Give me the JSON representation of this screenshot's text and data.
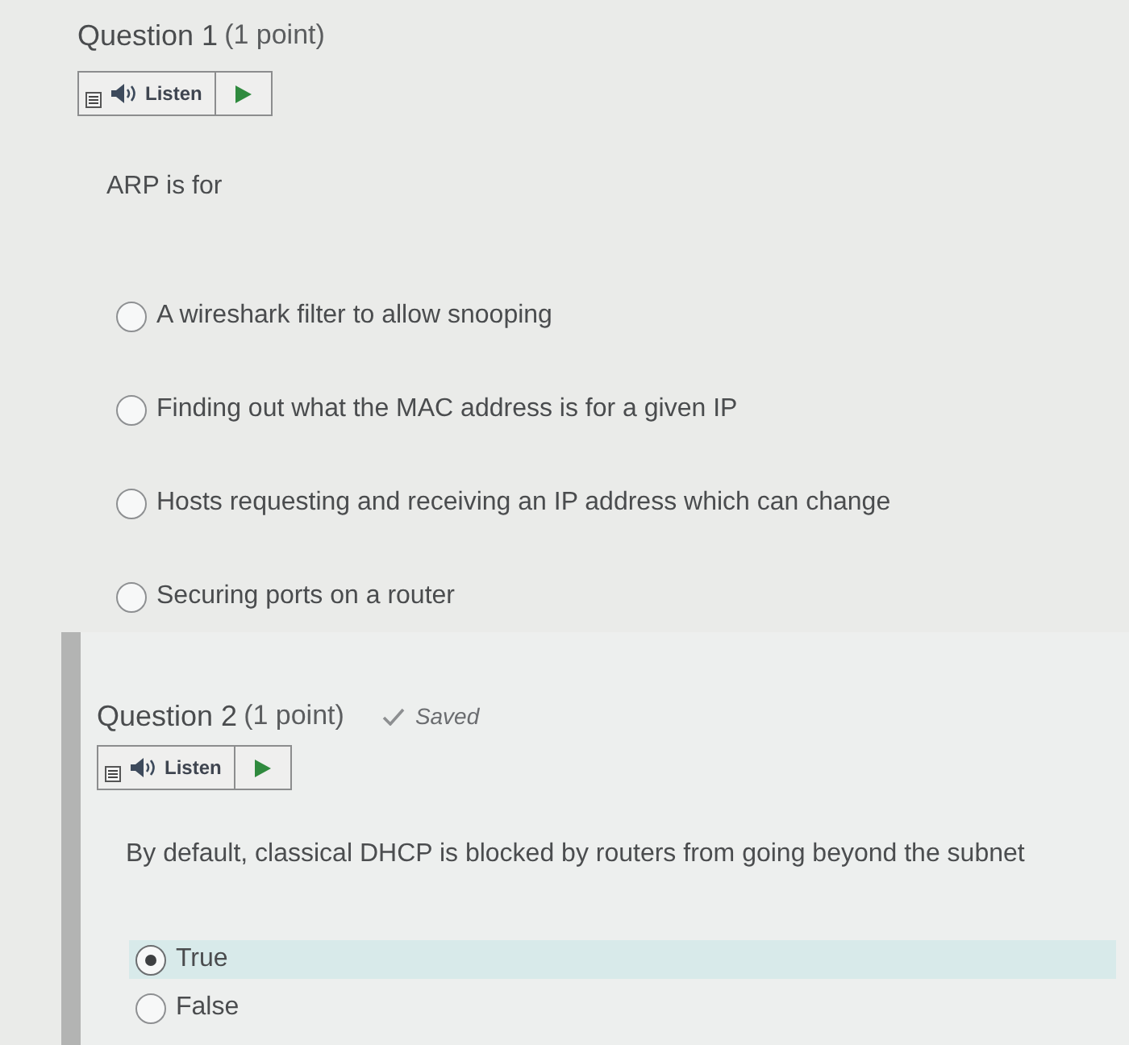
{
  "questions": [
    {
      "title": "Question 1",
      "points": "(1 point)",
      "kind": "multiple_choice",
      "active": false,
      "listen": {
        "label": "Listen"
      },
      "prompt": "ARP is for",
      "options": [
        {
          "text": "A wireshark filter to allow snooping",
          "selected": false
        },
        {
          "text": "Finding out what the MAC address is for a given IP",
          "selected": false
        },
        {
          "text": "Hosts requesting and receiving an IP address which can change",
          "selected": false
        },
        {
          "text": "Securing ports on a router",
          "selected": false
        }
      ]
    },
    {
      "title": "Question 2",
      "points": "(1 point)",
      "kind": "true_false",
      "active": true,
      "status": "Saved",
      "listen": {
        "label": "Listen"
      },
      "prompt": "By default, classical DHCP is blocked by routers from going beyond the subnet",
      "options": [
        {
          "text": "True",
          "selected": true
        },
        {
          "text": "False",
          "selected": false
        }
      ]
    }
  ]
}
